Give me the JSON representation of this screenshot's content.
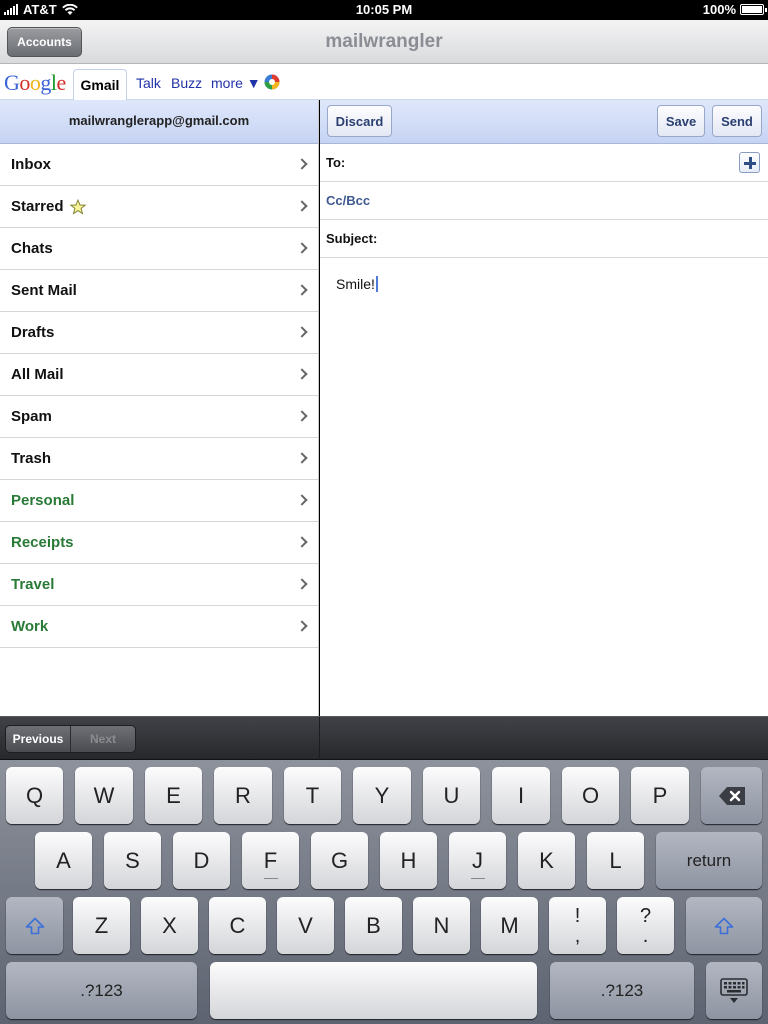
{
  "status_bar": {
    "carrier": "AT&T",
    "time": "10:05 PM",
    "battery": "100%",
    "battery_level": 1.0
  },
  "titlebar": {
    "title": "mailwrangler",
    "accounts_label": "Accounts"
  },
  "google_nav": {
    "logo": "Google",
    "logo_colors": [
      "#3c64d6",
      "#d22d28",
      "#f2b219",
      "#3c64d6",
      "#1d9a2e",
      "#d22d28"
    ],
    "tab_active": "Gmail",
    "links": [
      "Talk",
      "Buzz",
      "more ▼"
    ]
  },
  "left_pane": {
    "account": "mailwranglerapp@gmail.com",
    "folders": [
      "Inbox",
      "Starred",
      "Chats",
      "Sent Mail",
      "Drafts",
      "All Mail",
      "Spam",
      "Trash"
    ],
    "labels": [
      "Personal",
      "Receipts",
      "Travel",
      "Work"
    ],
    "label_color": "#2a7a37"
  },
  "compose": {
    "discard_label": "Discard",
    "save_label": "Save",
    "send_label": "Send",
    "to_label": "To:",
    "cc_label": "Cc/Bcc",
    "subject_label": "Subject:",
    "body": "Smile!"
  },
  "accessory": {
    "previous_label": "Previous",
    "next_label": "Next"
  },
  "keyboard": {
    "row1": [
      "Q",
      "W",
      "E",
      "R",
      "T",
      "Y",
      "U",
      "I",
      "O",
      "P"
    ],
    "row2": [
      "A",
      "S",
      "D",
      "F",
      "G",
      "H",
      "J",
      "K",
      "L"
    ],
    "row3": [
      "Z",
      "X",
      "C",
      "V",
      "B",
      "N",
      "M"
    ],
    "punct1": [
      "!",
      ","
    ],
    "punct2": [
      "?",
      "."
    ],
    "return_label": "return",
    "numbers_label": ".?123",
    "accent_color": "#3c6fd8"
  }
}
